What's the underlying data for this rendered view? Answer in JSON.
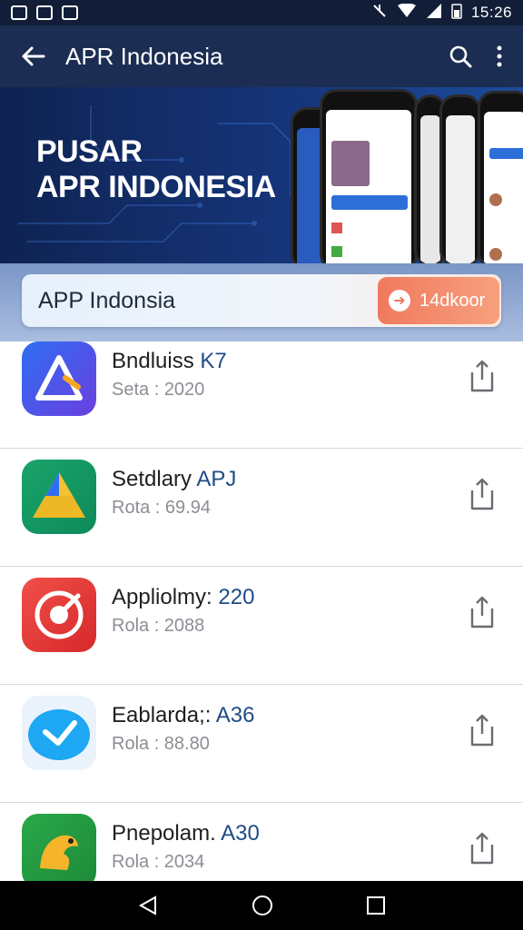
{
  "status_bar": {
    "time": "15:26"
  },
  "app_bar": {
    "title": "APR Indonesia",
    "back_icon": "arrow-left-icon",
    "search_icon": "search-icon",
    "more_icon": "more-vert-icon"
  },
  "banner": {
    "line1": "PUSAR",
    "line2": "APR INDONESIA"
  },
  "search": {
    "placeholder": "APP Indonsia",
    "button_label": "14dkoor"
  },
  "apps": [
    {
      "name": "Bndluiss",
      "tag": "K7",
      "sub": "Seta : 2020",
      "icon": "triangle-app-icon"
    },
    {
      "name": "Setdlary",
      "tag": "APJ",
      "sub": "Rota : 69.94",
      "icon": "drive-triangle-icon"
    },
    {
      "name": "Appliolmy:",
      "tag": "220",
      "sub": "Rola : 2088",
      "icon": "target-app-icon"
    },
    {
      "name": "Eablarda;:",
      "tag": "A36",
      "sub": "Rola : 88.80",
      "icon": "bird-app-icon"
    },
    {
      "name": "Pnepolam.",
      "tag": "A30",
      "sub": "Rola : 2034",
      "icon": "dragon-app-icon"
    }
  ],
  "colors": {
    "status_bar": "#121e38",
    "app_bar": "#1b2d52",
    "accent": "#1e4c86",
    "download_button": "#f07a5e"
  }
}
